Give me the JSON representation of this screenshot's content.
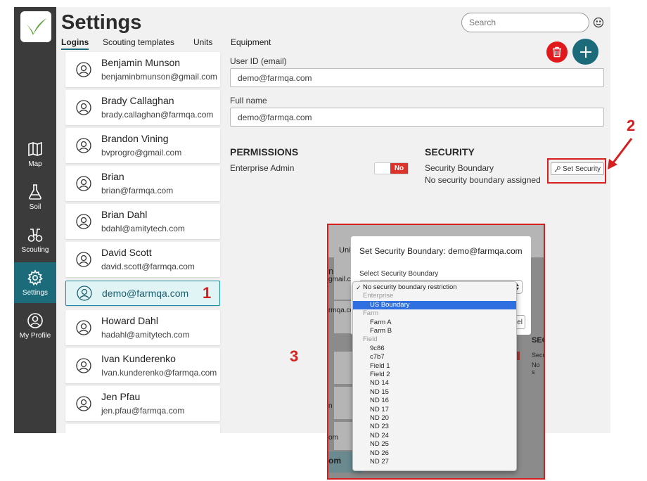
{
  "app": {
    "title": "Settings",
    "search_placeholder": "Search",
    "tabs": [
      {
        "label": "Logins",
        "active": true
      },
      {
        "label": "Scouting templates",
        "active": false
      },
      {
        "label": "Units",
        "active": false
      },
      {
        "label": "Equipment",
        "active": false
      }
    ]
  },
  "sidebar": {
    "items": [
      {
        "label": "Map",
        "icon": "map-icon"
      },
      {
        "label": "Soil",
        "icon": "flask-icon"
      },
      {
        "label": "Scouting",
        "icon": "binoculars-icon"
      },
      {
        "label": "Settings",
        "icon": "gear-icon",
        "active": true
      },
      {
        "label": "My Profile",
        "icon": "user-icon"
      }
    ]
  },
  "users": [
    {
      "name": "Benjamin Munson",
      "email": "benjaminbmunson@gmail.com"
    },
    {
      "name": "Brady Callaghan",
      "email": "brady.callaghan@farmqa.com"
    },
    {
      "name": "Brandon Vining",
      "email": "bvprogro@gmail.com"
    },
    {
      "name": "Brian",
      "email": "brian@farmqa.com"
    },
    {
      "name": "Brian Dahl",
      "email": "bdahl@amitytech.com"
    },
    {
      "name": "David Scott",
      "email": "david.scott@farmqa.com"
    },
    {
      "name": "demo@farmqa.com",
      "email": "",
      "selected": true
    },
    {
      "name": "Howard Dahl",
      "email": "hadahl@amitytech.com"
    },
    {
      "name": "Ivan Kunderenko",
      "email": "Ivan.kunderenko@farmqa.com"
    },
    {
      "name": "Jen Pfau",
      "email": "jen.pfau@farmqa.com"
    }
  ],
  "detail": {
    "user_id_label": "User ID (email)",
    "user_id_value": "demo@farmqa.com",
    "full_name_label": "Full name",
    "full_name_value": "demo@farmqa.com",
    "permissions_heading": "PERMISSIONS",
    "enterprise_admin_label": "Enterprise Admin",
    "toggle_value": "No",
    "security_heading": "SECURITY",
    "security_boundary_label": "Security Boundary",
    "security_boundary_status": "No security boundary assigned",
    "set_security_label": "Set Security"
  },
  "annotations": {
    "one": "1",
    "two": "2",
    "three": "3"
  },
  "dialog": {
    "title": "Set Security Boundary: demo@farmqa.com",
    "select_label": "Select Security Boundary",
    "cancel_fragment": "el",
    "background_fragments": {
      "tab": "Uni",
      "name": "n",
      "email1": "gmail.co",
      "email2": "rmqa.com",
      "sec_head": "SEC",
      "sec1": "Secu",
      "sec2": "No s",
      "row1": "n",
      "row2": "om",
      "row3": "om"
    },
    "options": [
      {
        "label": "No security boundary restriction",
        "type": "first",
        "checked": true
      },
      {
        "label": "Enterprise",
        "type": "group"
      },
      {
        "label": "US Boundary",
        "type": "item",
        "selected": true
      },
      {
        "label": "Farm",
        "type": "group"
      },
      {
        "label": "Farm A",
        "type": "item"
      },
      {
        "label": "Farm B",
        "type": "item"
      },
      {
        "label": "Field",
        "type": "group"
      },
      {
        "label": "9c86",
        "type": "item"
      },
      {
        "label": "c7b7",
        "type": "item"
      },
      {
        "label": "Field 1",
        "type": "item"
      },
      {
        "label": "Field 2",
        "type": "item"
      },
      {
        "label": "ND 14",
        "type": "item"
      },
      {
        "label": "ND 15",
        "type": "item"
      },
      {
        "label": "ND 16",
        "type": "item"
      },
      {
        "label": "ND 17",
        "type": "item"
      },
      {
        "label": "ND 20",
        "type": "item"
      },
      {
        "label": "ND 23",
        "type": "item"
      },
      {
        "label": "ND 24",
        "type": "item"
      },
      {
        "label": "ND 25",
        "type": "item"
      },
      {
        "label": "ND 26",
        "type": "item"
      },
      {
        "label": "ND 27",
        "type": "item"
      }
    ]
  },
  "colors": {
    "sidebar": "#3b3b3b",
    "accent": "#1b6b7b",
    "delete": "#e2191c",
    "annotation": "#d6201f",
    "dropdown_selected": "#2f6fe0"
  }
}
